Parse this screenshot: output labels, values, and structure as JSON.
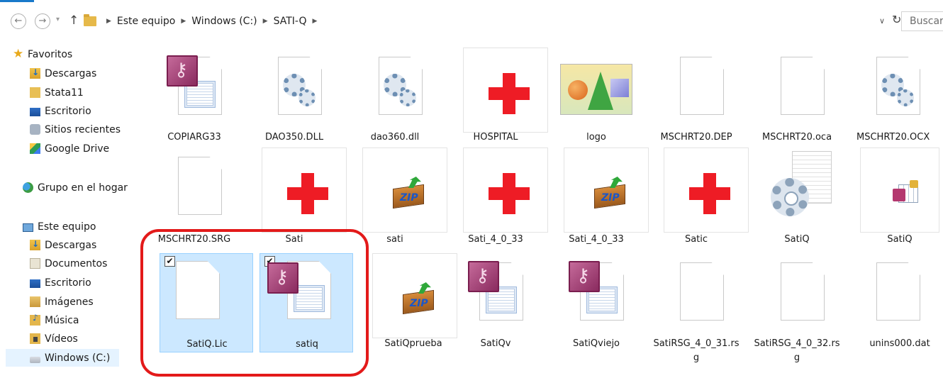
{
  "address": {
    "breadcrumbs": [
      "Este equipo",
      "Windows (C:)",
      "SATI-Q"
    ],
    "search_placeholder": "Buscar..."
  },
  "nav_icons": {
    "back": "back-arrow-icon",
    "forward": "forward-arrow-icon",
    "up": "up-arrow-icon",
    "refresh": "refresh-icon",
    "dropdown": "chevron-down-icon"
  },
  "sidebar": {
    "items": [
      {
        "label": "Favoritos",
        "icon": "star-icon"
      },
      {
        "label": "Descargas",
        "icon": "downloads-folder-icon"
      },
      {
        "label": "Stata11",
        "icon": "folder-icon"
      },
      {
        "label": "Escritorio",
        "icon": "desktop-icon"
      },
      {
        "label": "Sitios recientes",
        "icon": "recent-places-icon"
      },
      {
        "label": "Google Drive",
        "icon": "google-drive-icon"
      },
      {
        "label": "Grupo en el hogar",
        "icon": "homegroup-icon"
      },
      {
        "label": "Este equipo",
        "icon": "computer-icon"
      },
      {
        "label": "Descargas",
        "icon": "downloads-folder-icon"
      },
      {
        "label": "Documentos",
        "icon": "documents-folder-icon"
      },
      {
        "label": "Escritorio",
        "icon": "desktop-folder-icon"
      },
      {
        "label": "Imágenes",
        "icon": "pictures-folder-icon"
      },
      {
        "label": "Música",
        "icon": "music-folder-icon"
      },
      {
        "label": "Vídeos",
        "icon": "videos-folder-icon"
      },
      {
        "label": "Windows (C:)",
        "icon": "drive-icon",
        "selected": true
      }
    ]
  },
  "files": [
    {
      "name": "COPIARG33",
      "icon": "access-form-icon"
    },
    {
      "name": "DAO350.DLL",
      "icon": "dll-gear-icon"
    },
    {
      "name": "dao360.dll",
      "icon": "dll-gear-icon"
    },
    {
      "name": "HOSPITAL",
      "icon": "red-cross-icon"
    },
    {
      "name": "logo",
      "icon": "image-thumbnail-icon"
    },
    {
      "name": "MSCHRT20.DEP",
      "icon": "blank-file-icon"
    },
    {
      "name": "MSCHRT20.oca",
      "icon": "blank-file-icon"
    },
    {
      "name": "MSCHRT20.OCX",
      "icon": "dll-gear-icon"
    },
    {
      "name": "MSCHRT20.SRG",
      "icon": "blank-file-icon"
    },
    {
      "name": "Sati",
      "icon": "red-cross-icon"
    },
    {
      "name": "sati",
      "icon": "zip-archive-icon"
    },
    {
      "name": "Sati_4_0_33",
      "icon": "red-cross-icon"
    },
    {
      "name": "Sati_4_0_33",
      "icon": "zip-archive-icon"
    },
    {
      "name": "Satic",
      "icon": "red-cross-icon"
    },
    {
      "name": "SatiQ",
      "icon": "config-gear-icon"
    },
    {
      "name": "SatiQ",
      "icon": "access-database-icon"
    },
    {
      "name": "SatiQ.Lic",
      "icon": "blank-file-icon",
      "selected": true
    },
    {
      "name": "satiq",
      "icon": "access-form-icon",
      "selected": true
    },
    {
      "name": "SatiQprueba",
      "icon": "zip-archive-icon"
    },
    {
      "name": "SatiQv",
      "icon": "access-form-icon"
    },
    {
      "name": "SatiQviejo",
      "icon": "access-form-icon"
    },
    {
      "name": "SatiRSG_4_0_31.rs\ng",
      "icon": "blank-file-icon"
    },
    {
      "name": "SatiRSG_4_0_32.rs\ng",
      "icon": "blank-file-icon"
    },
    {
      "name": "unins000.dat",
      "icon": "blank-file-icon"
    }
  ],
  "colors": {
    "selection_bg": "#cce8ff",
    "selection_border": "#99d1ff",
    "highlight_outline": "#e31a1a",
    "cross_red": "#ee1c25"
  }
}
